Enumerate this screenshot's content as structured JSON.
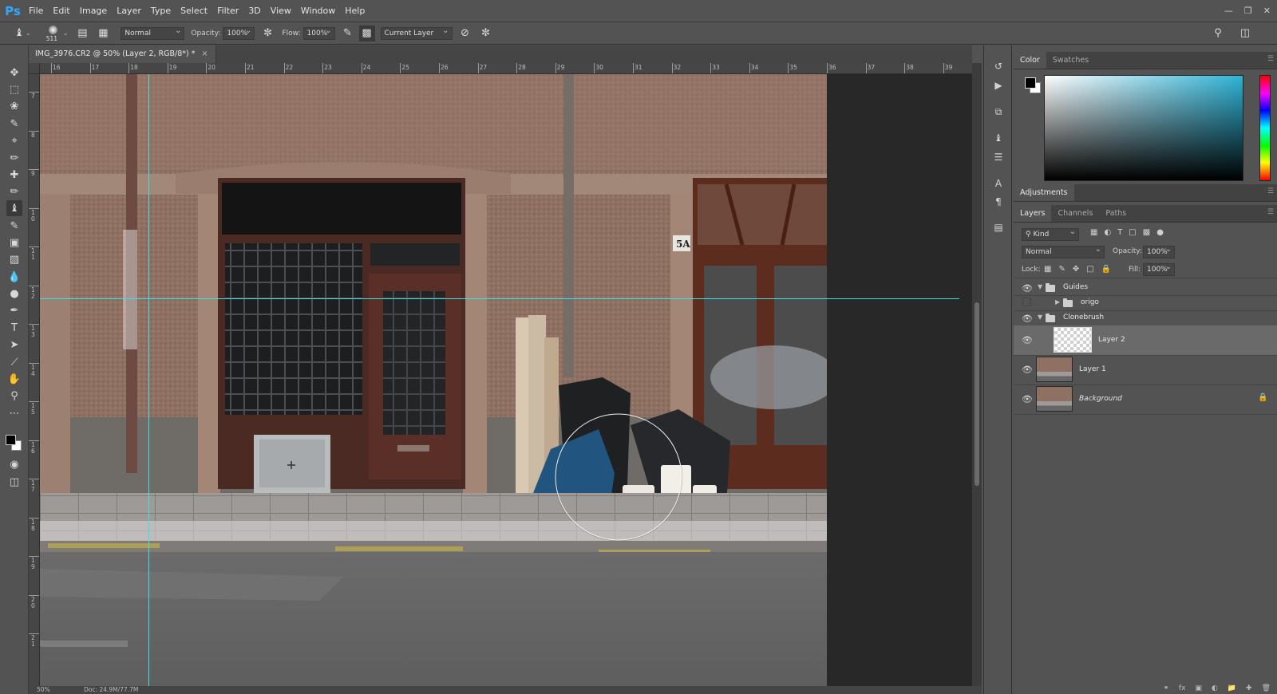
{
  "app": {
    "logo": "Ps",
    "menu": [
      "File",
      "Edit",
      "Image",
      "Layer",
      "Type",
      "Select",
      "Filter",
      "3D",
      "View",
      "Window",
      "Help"
    ]
  },
  "options": {
    "brush_size": "511",
    "mode": "Normal",
    "opacity_label": "Opacity:",
    "opacity_value": "100%",
    "flow_label": "Flow:",
    "flow_value": "100%",
    "sample": "Current Layer"
  },
  "document": {
    "tab_title": "IMG_3976.CR2 @ 50% (Layer 2, RGB/8*) *",
    "tab_close": "×",
    "status_zoom": "50%",
    "status_doc": "Doc: 24.9M/77.7M",
    "ruler_h": [
      "16",
      "17",
      "18",
      "19",
      "20",
      "21",
      "22",
      "23",
      "24",
      "25",
      "26",
      "27",
      "28",
      "29",
      "30",
      "31",
      "32",
      "33",
      "34",
      "35",
      "36",
      "37",
      "38",
      "39"
    ],
    "ruler_v": [
      "7",
      "8",
      "9",
      "1 0",
      "1 1",
      "1 2",
      "1 3",
      "1 4",
      "1 5",
      "1 6",
      "1 7",
      "1 8",
      "1 9",
      "2 0",
      "2 1"
    ],
    "house_number": "5A"
  },
  "panels": {
    "color_tabs": [
      "Color",
      "Swatches"
    ],
    "adjustments_title": "Adjustments",
    "layer_tabs": [
      "Layers",
      "Channels",
      "Paths"
    ],
    "kind_label": "Kind",
    "blend_mode": "Normal",
    "opacity_label": "Opacity:",
    "opacity_value": "100%",
    "lock_label": "Lock:",
    "fill_label": "Fill:",
    "fill_value": "100%",
    "layers": [
      {
        "name": "Guides"
      },
      {
        "name": "origo"
      },
      {
        "name": "Clonebrush"
      },
      {
        "name": "Layer 2"
      },
      {
        "name": "Layer 1"
      },
      {
        "name": "Background"
      }
    ]
  },
  "colors": {
    "accent": "#31a8ff",
    "guide": "#3fe0e0",
    "ui_bg": "#535353"
  }
}
